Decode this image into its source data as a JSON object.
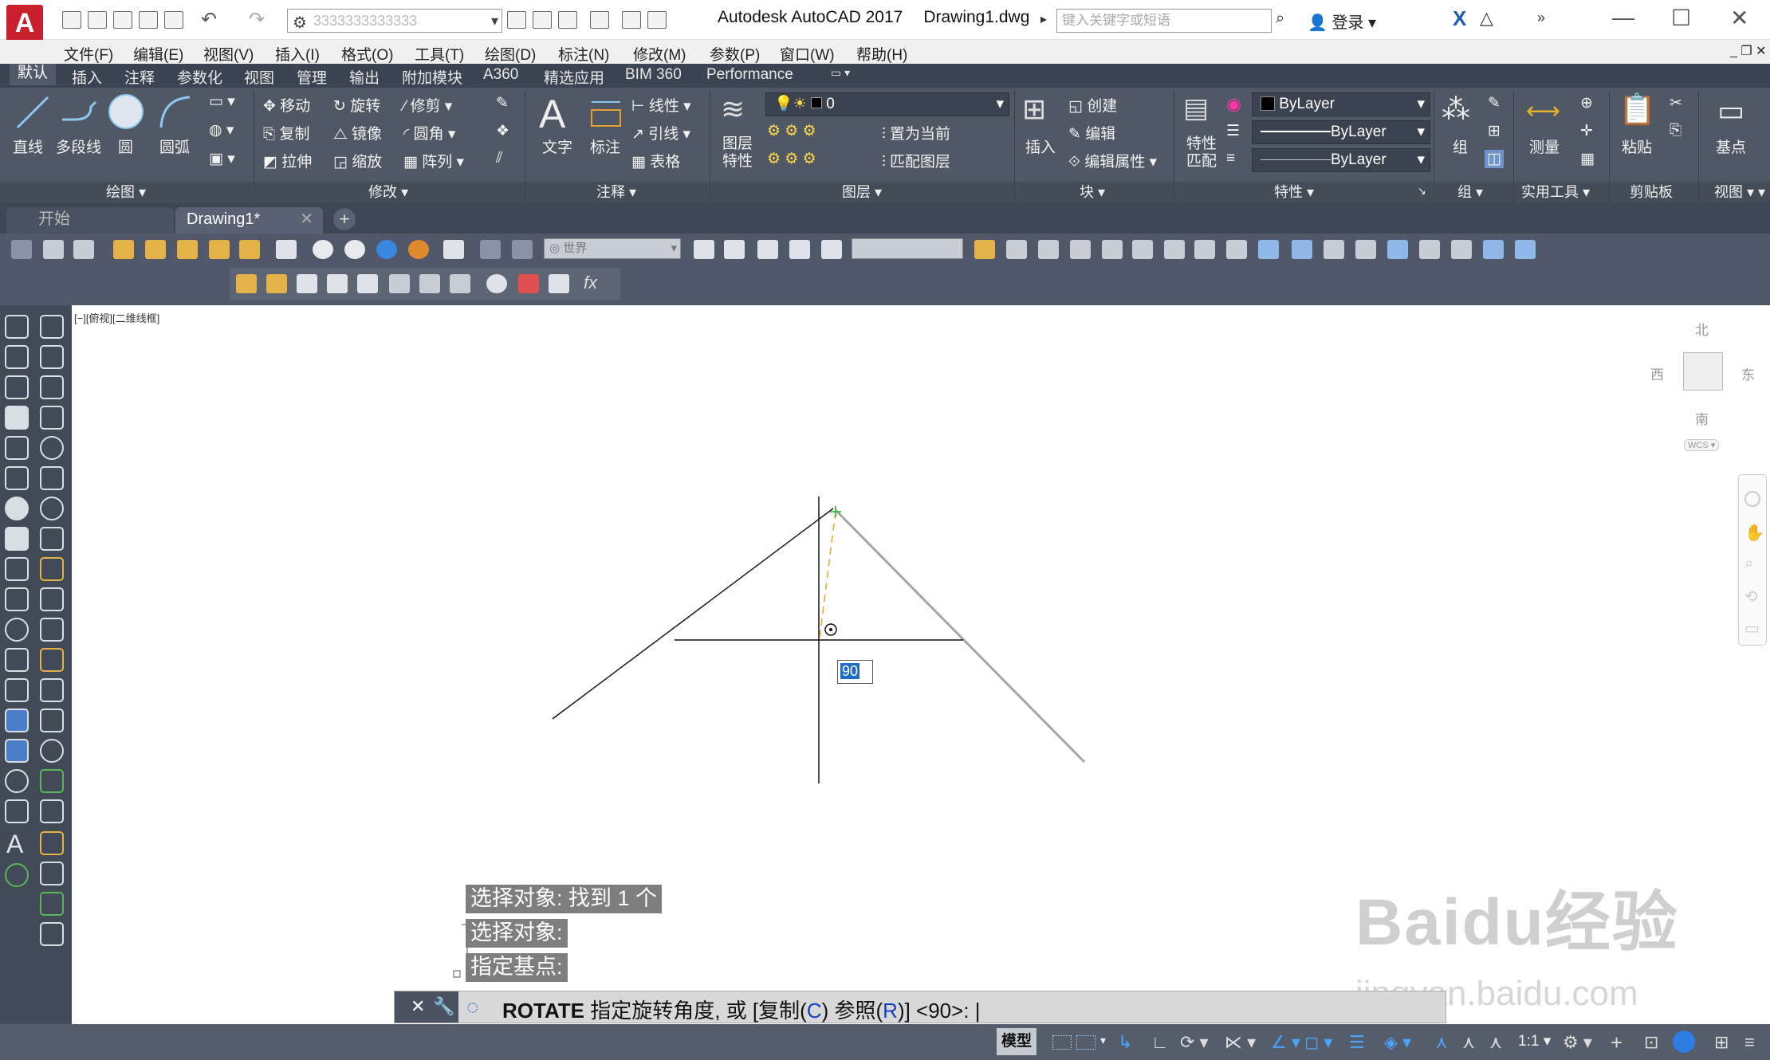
{
  "window": {
    "app_title": "Autodesk AutoCAD 2017",
    "doc_title": "Drawing1.dwg",
    "workspace": "3333333333333",
    "search_placeholder": "键入关键字或短语",
    "login": "登录",
    "minimize": "—",
    "maximize": "☐",
    "close": "✕"
  },
  "menu": [
    "文件(F)",
    "编辑(E)",
    "视图(V)",
    "插入(I)",
    "格式(O)",
    "工具(T)",
    "绘图(D)",
    "标注(N)",
    "修改(M)",
    "参数(P)",
    "窗口(W)",
    "帮助(H)"
  ],
  "ribbon_tabs": [
    "默认",
    "插入",
    "注释",
    "参数化",
    "视图",
    "管理",
    "输出",
    "附加模块",
    "A360",
    "精选应用",
    "BIM 360",
    "Performance"
  ],
  "ribbon": {
    "draw": {
      "line": "直线",
      "polyline": "多段线",
      "circle": "圆",
      "arc": "圆弧",
      "panel": "绘图"
    },
    "modify": {
      "move": "移动",
      "rotate": "旋转",
      "trim": "修剪",
      "copy": "复制",
      "mirror": "镜像",
      "fillet": "圆角",
      "stretch": "拉伸",
      "scale": "缩放",
      "array": "阵列",
      "panel": "修改"
    },
    "annotation": {
      "text": "文字",
      "dimension": "标注",
      "linear": "线性",
      "leader": "引线",
      "table": "表格",
      "panel": "注释"
    },
    "layers": {
      "layer_props": "图层\n特性",
      "current_layer": "0",
      "make_current": "置为当前",
      "match_layer": "匹配图层",
      "panel": "图层"
    },
    "block": {
      "insert": "插入",
      "create": "创建",
      "edit": "编辑",
      "edit_attr": "编辑属性",
      "panel": "块"
    },
    "properties": {
      "match": "特性\n匹配",
      "color": "ByLayer",
      "linetype": "ByLayer",
      "lineweight": "ByLayer",
      "panel": "特性"
    },
    "groups": {
      "group": "组",
      "panel": "组"
    },
    "utilities": {
      "measure": "测量",
      "panel": "实用工具"
    },
    "clipboard": {
      "paste": "粘贴",
      "panel": "剪贴板"
    },
    "view": {
      "base": "基点",
      "panel": "视图"
    }
  },
  "doc_tabs": {
    "start": "开始",
    "drawing": "Drawing1*",
    "add": "+"
  },
  "toolbar": {
    "ucs_combo": "世界"
  },
  "viewport": {
    "label": "[−][俯视][二维线框]",
    "north": "北",
    "south": "南",
    "east": "东",
    "west": "西",
    "wcs": "WCS",
    "angle_value": "90"
  },
  "command_history": [
    "选择对象: 找到 1 个",
    "选择对象:",
    "指定基点:"
  ],
  "command_line": {
    "prefix": "ROTATE",
    "prompt": "指定旋转角度, 或 [复制(",
    "opt1": "C",
    "mid": ") 参照(",
    "opt2": "R",
    "suffix": ")] <90>:"
  },
  "status": {
    "model": "模型",
    "scale": "1:1"
  },
  "watermark": {
    "line1": "Baidu经验",
    "line2": "jingyan.baidu.com"
  },
  "colors": {
    "ribbon": "#505865",
    "accent": "#1f6dc4",
    "logo": "#c8202d"
  }
}
